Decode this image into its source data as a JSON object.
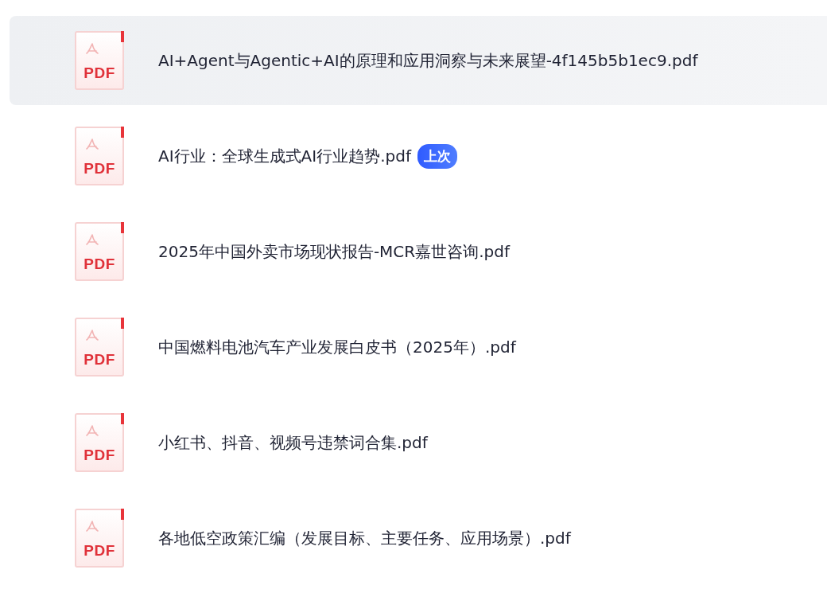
{
  "files": [
    {
      "icon_label": "PDF",
      "name": "AI+Agent与Agentic+AI的原理和应用洞察与未来展望-4f145b5b1ec9.pdf",
      "selected": true
    },
    {
      "icon_label": "PDF",
      "name": "AI行业：全球生成式AI行业趋势.pdf",
      "selected": false,
      "badge": "上次"
    },
    {
      "icon_label": "PDF",
      "name": "2025年中国外卖市场现状报告-MCR嘉世咨询.pdf",
      "selected": false
    },
    {
      "icon_label": "PDF",
      "name": "中国燃料电池汽车产业发展白皮书（2025年）.pdf",
      "selected": false
    },
    {
      "icon_label": "PDF",
      "name": "小红书、抖音、视频号违禁词合集.pdf",
      "selected": false
    },
    {
      "icon_label": "PDF",
      "name": "各地低空政策汇编（发展目标、主要任务、应用场景）.pdf",
      "selected": false
    }
  ]
}
